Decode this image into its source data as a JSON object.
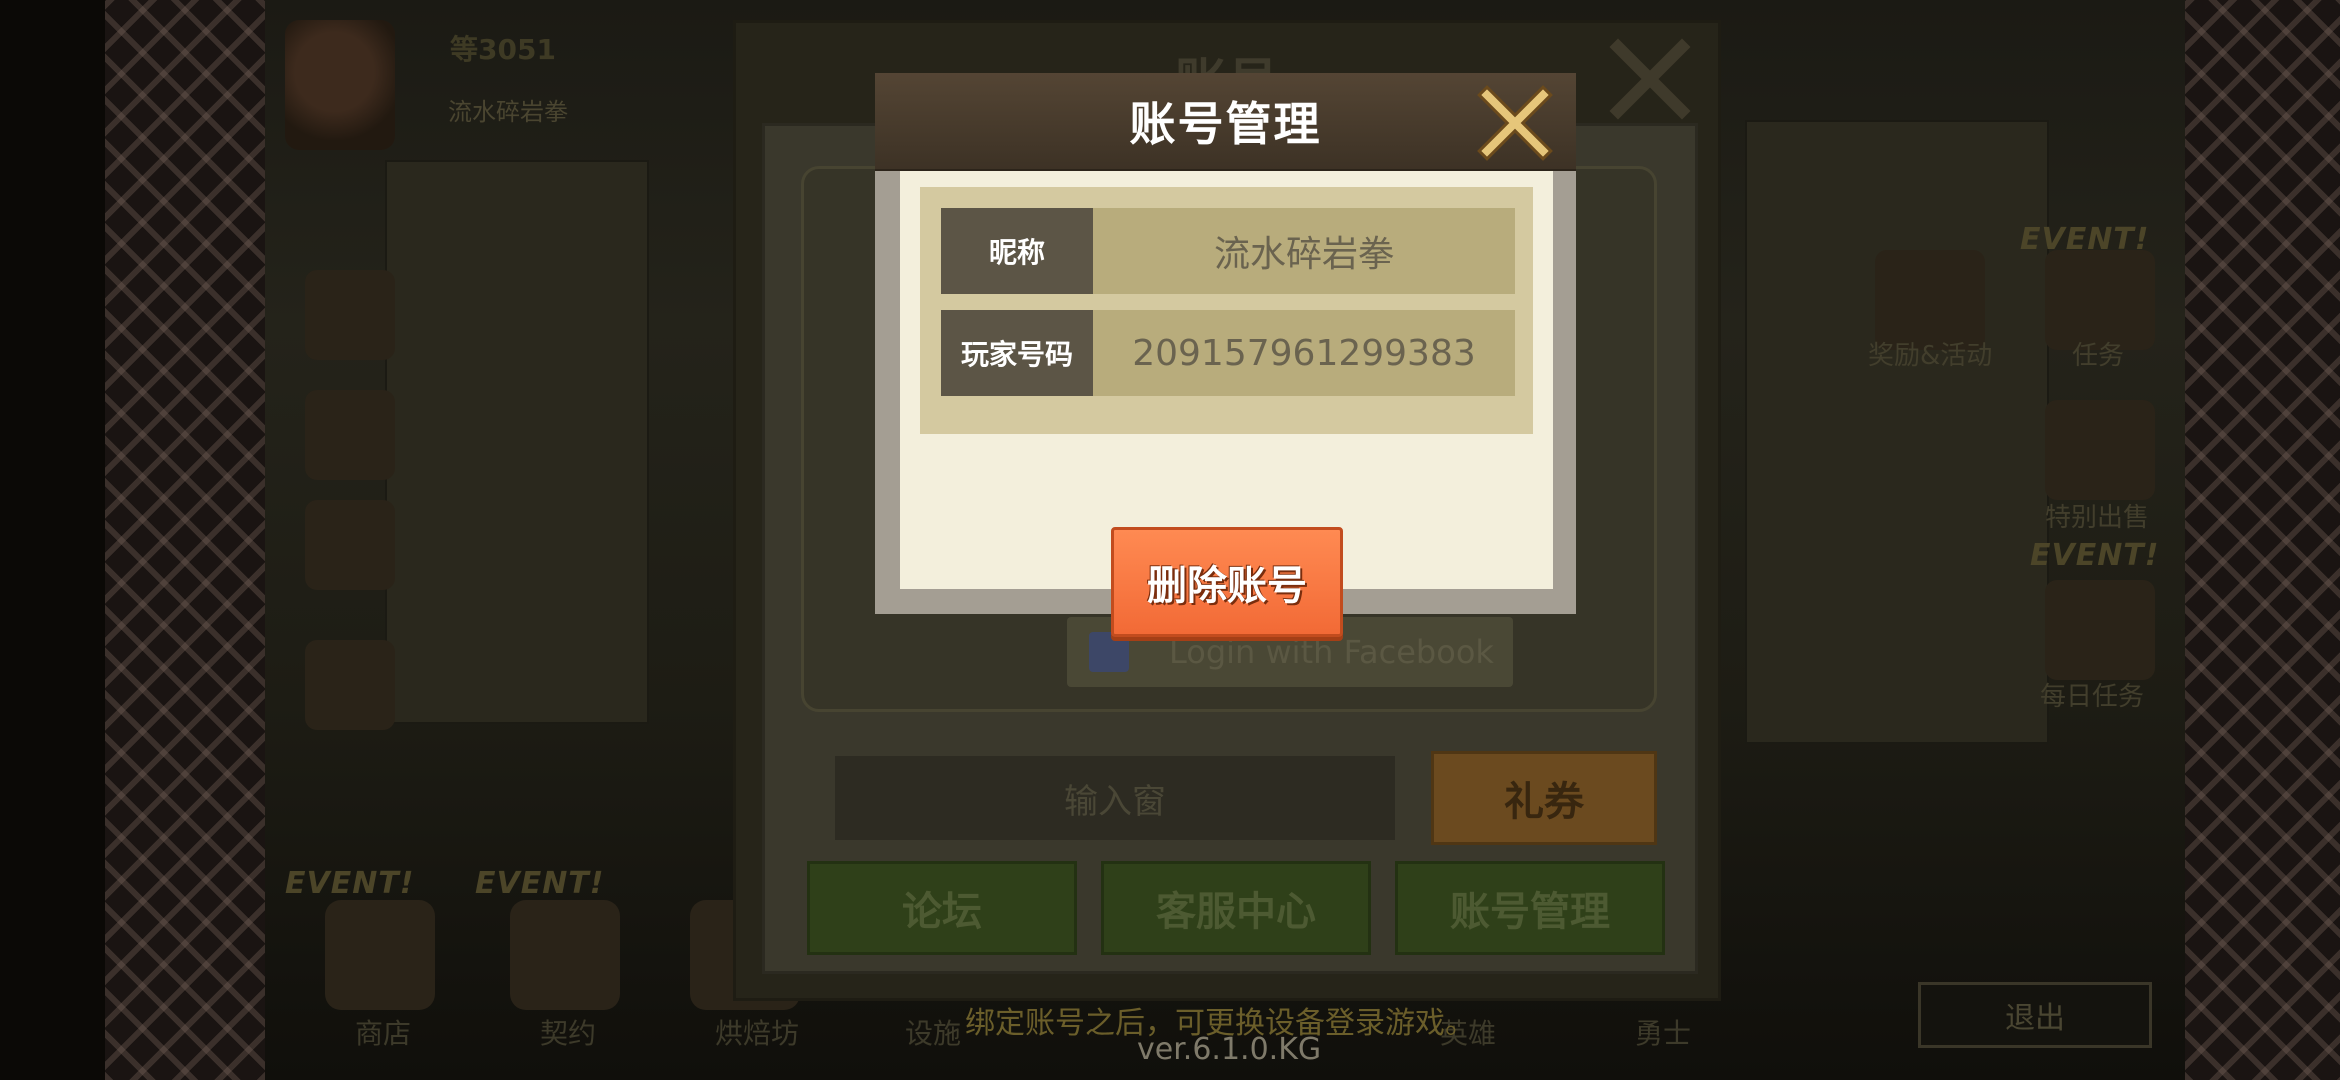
{
  "background": {
    "player": {
      "level": "等3051",
      "name": "流水碎岩拳"
    },
    "event_tags": [
      "EVENT!",
      "EVENT!",
      "EVENT!",
      "EVENT!"
    ],
    "right_labels": [
      "奖励&活动",
      "任务",
      "特别出售",
      "每日任务"
    ],
    "bottom_labels": [
      "商店",
      "契约",
      "烘焙坊",
      "设施",
      "英雄",
      "勇士"
    ],
    "exit_label": "退出",
    "bind_tip": "绑定账号之后，可更换设备登录游戏。",
    "version": "ver.6.1.0.KG"
  },
  "settings_panel": {
    "title": "账号",
    "facebook_label": "Login with Facebook",
    "coupon_placeholder": "输入窗",
    "coupon_button": "礼券",
    "buttons": [
      "论坛",
      "客服中心",
      "账号管理"
    ]
  },
  "popup": {
    "title": "账号管理",
    "rows": [
      {
        "label": "昵称",
        "value": "流水碎岩拳"
      },
      {
        "label": "玩家号码",
        "value": "209157961299383"
      }
    ],
    "delete_button": "删除账号"
  },
  "colors": {
    "popup_header": "#3d3225",
    "delete_button": "#f26a36",
    "label_bg": "#5c5546",
    "value_bg": "#b8ac7c",
    "body_bg": "#f3efdc"
  }
}
